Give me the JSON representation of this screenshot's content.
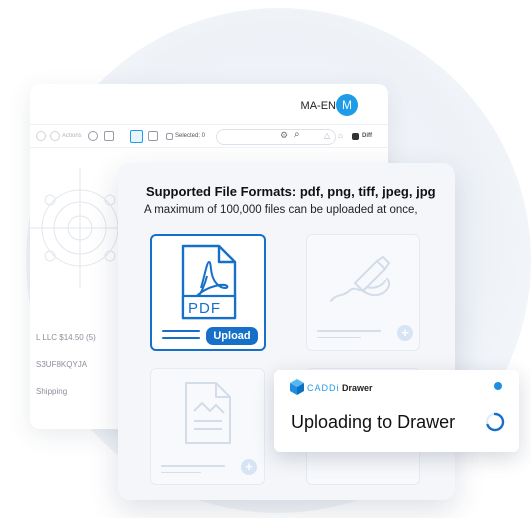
{
  "colors": {
    "accent": "#1670c9",
    "avatar": "#1e9ce8",
    "status_dot": "#1e8ee0"
  },
  "background_app": {
    "user_code": "MA-EN",
    "avatar_initial": "M",
    "toolbar": {
      "actions_label": "Actions",
      "selected_label": "Selected: 0",
      "diff_label": "Diff"
    },
    "rows": {
      "price": "L LLC  $14.50 (5)",
      "sku": "S3UF8KQYJA",
      "shipping": "Shipping"
    }
  },
  "panel": {
    "headline": "Supported File Formats: pdf, png, tiff, jpeg, jpg",
    "subline": "A maximum of 100,000 files can be uploaded at once,",
    "upload_card": {
      "file_type": "PDF",
      "button_label": "Upload"
    },
    "icons": {
      "pdf": "pdf-file-icon",
      "drawing": "hand-drawing-icon",
      "image": "image-file-icon"
    }
  },
  "toast": {
    "brand_logo": "CADDi",
    "brand_product": "Drawer",
    "title": "Uploading to Drawer",
    "icons": {
      "logo": "caddi-cube-icon",
      "spinner": "loading-spinner-icon"
    }
  }
}
